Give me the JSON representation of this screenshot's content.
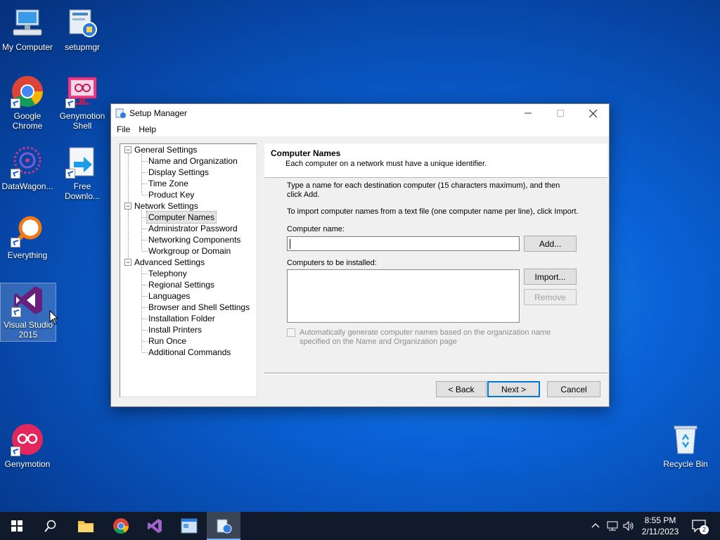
{
  "desktop": {
    "icons": [
      {
        "label": "My Computer"
      },
      {
        "label": "setupmgr"
      },
      {
        "label": "Google Chrome"
      },
      {
        "label": "Genymotion Shell"
      },
      {
        "label": "DataWagon..."
      },
      {
        "label": "Free Downlo..."
      },
      {
        "label": "Everything"
      },
      {
        "label": "Visual Studio 2015"
      },
      {
        "label": "Genymotion"
      },
      {
        "label": "Recycle Bin"
      }
    ]
  },
  "window": {
    "title": "Setup Manager",
    "menu": [
      "File",
      "Help"
    ],
    "tree": [
      {
        "label": "General Settings",
        "level": 0
      },
      {
        "label": "Name and Organization",
        "level": 1
      },
      {
        "label": "Display Settings",
        "level": 1
      },
      {
        "label": "Time Zone",
        "level": 1
      },
      {
        "label": "Product Key",
        "level": 1
      },
      {
        "label": "Network Settings",
        "level": 0
      },
      {
        "label": "Computer Names",
        "level": 1,
        "selected": true
      },
      {
        "label": "Administrator Password",
        "level": 1
      },
      {
        "label": "Networking Components",
        "level": 1
      },
      {
        "label": "Workgroup or Domain",
        "level": 1
      },
      {
        "label": "Advanced Settings",
        "level": 0
      },
      {
        "label": "Telephony",
        "level": 1
      },
      {
        "label": "Regional Settings",
        "level": 1
      },
      {
        "label": "Languages",
        "level": 1
      },
      {
        "label": "Browser and Shell Settings",
        "level": 1
      },
      {
        "label": "Installation Folder",
        "level": 1
      },
      {
        "label": "Install Printers",
        "level": 1
      },
      {
        "label": "Run Once",
        "level": 1
      },
      {
        "label": "Additional Commands",
        "level": 1
      }
    ],
    "panel": {
      "heading": "Computer Names",
      "subheading": "Each computer on a network must have a unique identifier.",
      "instruction1": "Type a name for each destination computer (15 characters maximum), and then click Add.",
      "instruction2": "To import computer names from a text file (one computer name per line), click Import.",
      "computer_name_label": "Computer name:",
      "computer_name_value": "",
      "add_label": "Add...",
      "computers_label": "Computers to be installed:",
      "import_label": "Import...",
      "remove_label": "Remove",
      "auto_generate_label": "Automatically generate computer names based on the organization name specified on the Name and Organization page",
      "auto_generate_checked": false
    },
    "buttons": {
      "back": "< Back",
      "next": "Next >",
      "cancel": "Cancel"
    }
  },
  "taskbar": {
    "time": "8:55 PM",
    "date": "2/11/2023",
    "notifications": "2"
  }
}
